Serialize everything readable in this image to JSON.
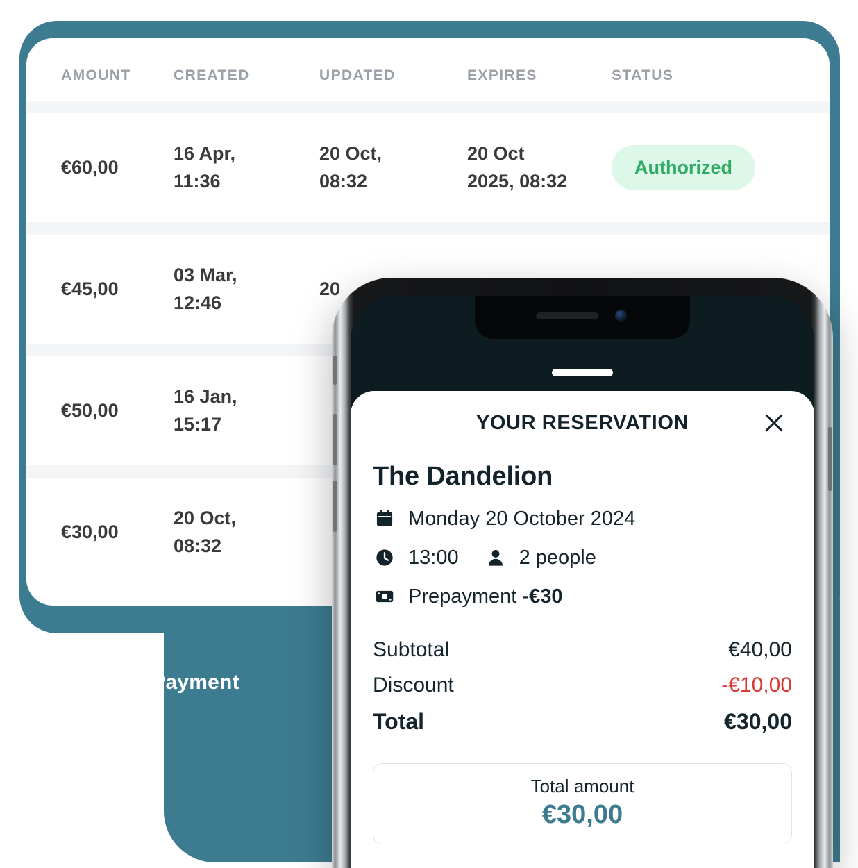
{
  "payments_table": {
    "columns": [
      "AMOUNT",
      "CREATED",
      "UPDATED",
      "EXPIRES",
      "STATUS"
    ],
    "rows": [
      {
        "amount": "€60,00",
        "created_date": "16 Apr,",
        "created_time": "11:36",
        "updated_date": "20 Oct,",
        "updated_time": "08:32",
        "expires_date": "20 Oct",
        "expires_time": "2025, 08:32",
        "status": "Authorized"
      },
      {
        "amount": "€45,00",
        "created_date": "03 Mar,",
        "created_time": "12:46",
        "updated_date": "20",
        "updated_time": "",
        "expires_date": "",
        "expires_time": "",
        "status": ""
      },
      {
        "amount": "€50,00",
        "created_date": "16 Jan,",
        "created_time": "15:17",
        "updated_date": "",
        "updated_time": "",
        "expires_date": "",
        "expires_time": "",
        "status": ""
      },
      {
        "amount": "€30,00",
        "created_date": "20 Oct,",
        "created_time": "08:32",
        "updated_date": "",
        "updated_time": "",
        "expires_date": "",
        "expires_time": "",
        "status": ""
      }
    ]
  },
  "new_payment_button": "+ New Payment",
  "phone": {
    "sheet": {
      "header_title": "YOUR RESERVATION",
      "close_icon": "close-icon",
      "venue_name": "The Dandelion",
      "details": {
        "calendar_icon": "calendar-icon",
        "date": "Monday 20 October 2024",
        "clock_icon": "clock-icon",
        "time": "13:00",
        "people_icon": "person-icon",
        "people": "2 people",
        "money_icon": "banknote-icon",
        "prepayment_label": "Prepayment - ",
        "prepayment_amount": "€30"
      },
      "summary": {
        "subtotal_label": "Subtotal",
        "subtotal_value": "€40,00",
        "discount_label": "Discount",
        "discount_value": "-€10,00",
        "total_label": "Total",
        "total_value": "€30,00"
      },
      "total_box": {
        "label": "Total amount",
        "amount": "€30,00"
      }
    }
  },
  "colors": {
    "teal": "#3d7b90",
    "badge_bg": "#ddf7e8",
    "badge_text": "#2faa63",
    "discount_red": "#d93a34",
    "ink": "#13232b"
  }
}
